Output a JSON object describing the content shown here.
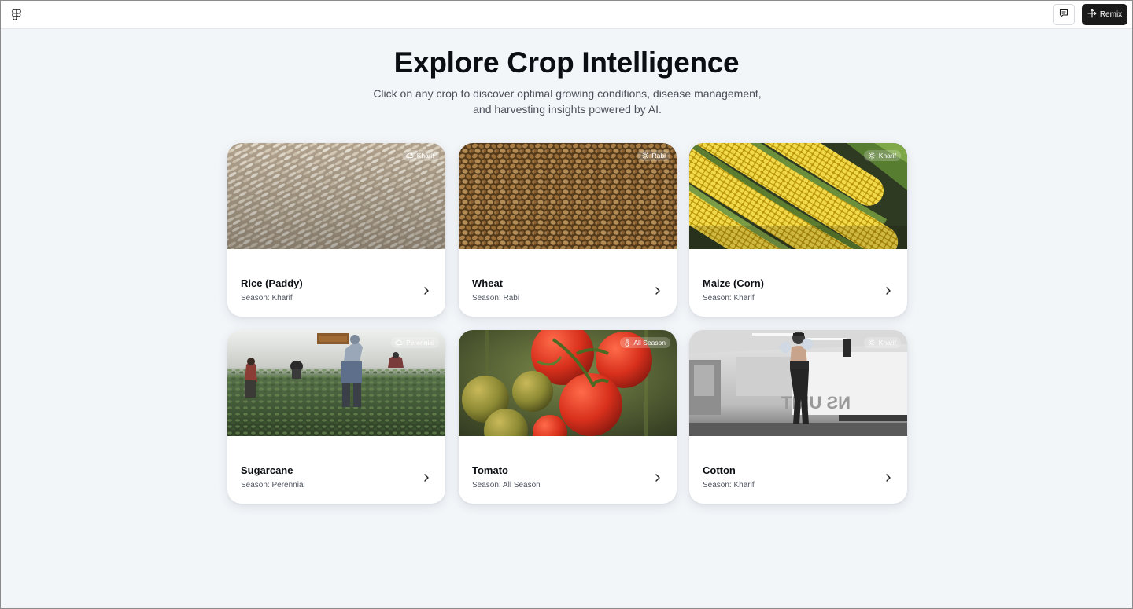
{
  "toolbar": {
    "logo_icon": "figma-logo-icon",
    "comment_icon": "comment-icon",
    "remix_icon": "remix-icon",
    "remix_label": "Remix"
  },
  "hero": {
    "title": "Explore Crop Intelligence",
    "subtitle_line1": "Click on any crop to discover optimal growing conditions, disease management,",
    "subtitle_line2": "and harvesting insights powered by AI."
  },
  "crops": [
    {
      "name": "Rice (Paddy)",
      "season_text": "Season: Kharif",
      "badge": "Kharif",
      "badge_icon": "rain-cloud-icon"
    },
    {
      "name": "Wheat",
      "season_text": "Season: Rabi",
      "badge": "Rabi",
      "badge_icon": "sun-icon"
    },
    {
      "name": "Maize (Corn)",
      "season_text": "Season: Kharif",
      "badge": "Kharif",
      "badge_icon": "sun-icon"
    },
    {
      "name": "Sugarcane",
      "season_text": "Season: Perennial",
      "badge": "Perennial",
      "badge_icon": "rain-cloud-icon"
    },
    {
      "name": "Tomato",
      "season_text": "Season: All Season",
      "badge": "All Season",
      "badge_icon": "thermometer-icon"
    },
    {
      "name": "Cotton",
      "season_text": "Season: Kharif",
      "badge": "Kharif",
      "badge_icon": "sun-icon"
    }
  ],
  "colors": {
    "background": "#f3f6f9",
    "card": "#ffffff",
    "title": "#0b0f14",
    "muted_text": "#4f5560",
    "remix_button": "#1a1a1a"
  }
}
